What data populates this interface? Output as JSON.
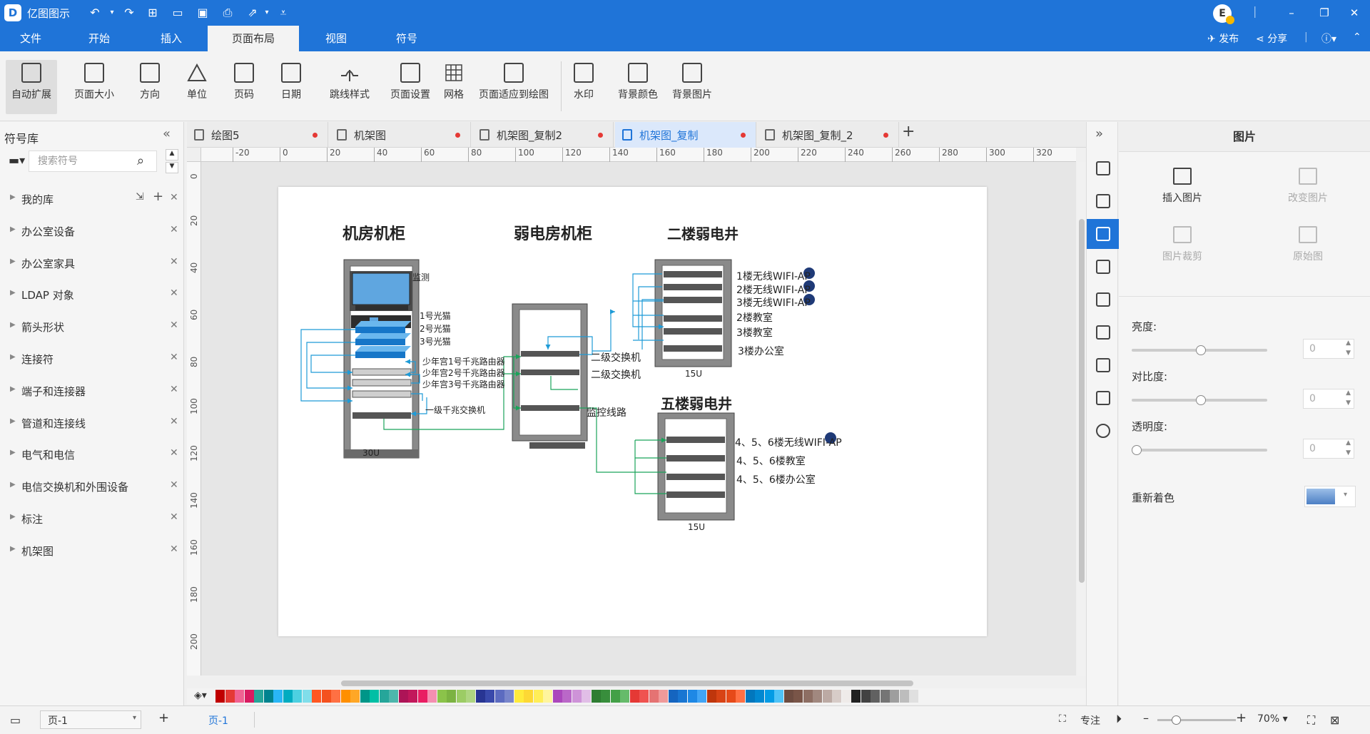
{
  "app": {
    "name": "亿图图示",
    "logo": "D"
  },
  "window": {
    "user_initial": "E"
  },
  "menu": {
    "tabs": [
      "文件",
      "开始",
      "插入",
      "页面布局",
      "视图",
      "符号"
    ],
    "active_tab": "页面布局",
    "right": {
      "publish": "发布",
      "share": "分享"
    }
  },
  "ribbon": {
    "buttons": [
      "自动扩展",
      "页面大小",
      "方向",
      "单位",
      "页码",
      "日期",
      "跳线样式",
      "页面设置",
      "网格",
      "页面适应到绘图",
      "水印",
      "背景颜色",
      "背景图片"
    ],
    "active": "自动扩展"
  },
  "library": {
    "title": "符号库",
    "search_placeholder": "搜索符号",
    "items": [
      "我的库",
      "办公室设备",
      "办公室家具",
      "LDAP 对象",
      "箭头形状",
      "连接符",
      "端子和连接器",
      "管道和连接线",
      "电气和电信",
      "电信交换机和外围设备",
      "标注",
      "机架图"
    ]
  },
  "doc_tabs": [
    {
      "label": "绘图5",
      "active": false
    },
    {
      "label": "机架图",
      "active": false
    },
    {
      "label": "机架图_复制2",
      "active": false
    },
    {
      "label": "机架图_复制",
      "active": true
    },
    {
      "label": "机架图_复制_2",
      "active": false
    }
  ],
  "ruler": {
    "h": [
      "-20",
      "0",
      "20",
      "40",
      "60",
      "80",
      "100",
      "120",
      "140",
      "160",
      "180",
      "200",
      "220",
      "240",
      "260",
      "280",
      "300",
      "320"
    ],
    "v": [
      "0",
      "20",
      "40",
      "60",
      "80",
      "100",
      "120",
      "140",
      "160",
      "180",
      "200"
    ]
  },
  "diagram": {
    "titles": {
      "machine_room": "机房机柜",
      "weak_room": "弱电房机柜",
      "floor2": "二楼弱电井",
      "floor5": "五楼弱电井"
    },
    "rack1": {
      "monitor": "监测",
      "cats": [
        "1号光猫",
        "2号光猫",
        "3号光猫"
      ],
      "routers": [
        "少年宫1号千兆路由器",
        "少年宫2号千兆路由器",
        "少年宫3号千兆路由器"
      ],
      "switch": "一级千兆交换机",
      "size": "30U"
    },
    "rack2": {
      "sw1": "二级交换机",
      "sw2": "二级交换机",
      "mon": "监控线路"
    },
    "rack3": {
      "items": [
        "1楼无线WIFI-AP",
        "2楼无线WIFI-AP",
        "3楼无线WIFI-AP",
        "2楼教室",
        "3楼教室",
        "3楼办公室"
      ],
      "size": "15U"
    },
    "rack4": {
      "items": [
        "4、5、6楼无线WIFI-AP",
        "4、5、6楼教室",
        "4、5、6楼办公室"
      ],
      "size": "15U"
    }
  },
  "right_panel": {
    "title": "图片",
    "buttons": [
      "插入图片",
      "改变图片",
      "图片裁剪",
      "原始图"
    ],
    "brightness": {
      "label": "亮度:",
      "value": "0"
    },
    "contrast": {
      "label": "对比度:",
      "value": "0"
    },
    "transparency": {
      "label": "透明度:",
      "value": "0"
    },
    "recolor": "重新着色"
  },
  "status": {
    "page_select": "页-1",
    "page_tab": "页-1",
    "focus": "专注",
    "zoom": "70%"
  },
  "colors": {
    "accent": "#1f74d8",
    "wire_blue": "#1e9bd7",
    "wire_green": "#1aa35a",
    "palette": [
      "#c00000",
      "#e53935",
      "#f06292",
      "#d81b60",
      "#26a69a",
      "#00838f",
      "#29b6f6",
      "#00acc1",
      "#4dd0e1",
      "#80deea",
      "#ff5722",
      "#f4511e",
      "#ff7043",
      "#ff8f00",
      "#ffa726",
      "#009688",
      "#00bfa5",
      "#26a69a",
      "#4db6ac",
      "#ad1457",
      "#c2185b",
      "#e91e63",
      "#f48fb1",
      "#8bc34a",
      "#7cb342",
      "#9ccc65",
      "#aed581",
      "#283593",
      "#3949ab",
      "#5c6bc0",
      "#7986cb",
      "#ffeb3b",
      "#fdd835",
      "#ffee58",
      "#fff59d",
      "#ab47bc",
      "#ba68c8",
      "#ce93d8",
      "#e1bee7",
      "#2e7d32",
      "#388e3c",
      "#43a047",
      "#66bb6a",
      "#e53935",
      "#ef5350",
      "#e57373",
      "#ef9a9a",
      "#1565c0",
      "#1976d2",
      "#1e88e5",
      "#42a5f5",
      "#bf360c",
      "#d84315",
      "#e64a19",
      "#ff7043",
      "#0277bd",
      "#0288d1",
      "#039be5",
      "#4fc3f7",
      "#6d4c41",
      "#795548",
      "#8d6e63",
      "#a1887f",
      "#bcaaa4",
      "#d7ccc8",
      "#efebe9",
      "#212121",
      "#424242",
      "#616161",
      "#757575",
      "#9e9e9e",
      "#bdbdbd",
      "#e0e0e0"
    ]
  }
}
